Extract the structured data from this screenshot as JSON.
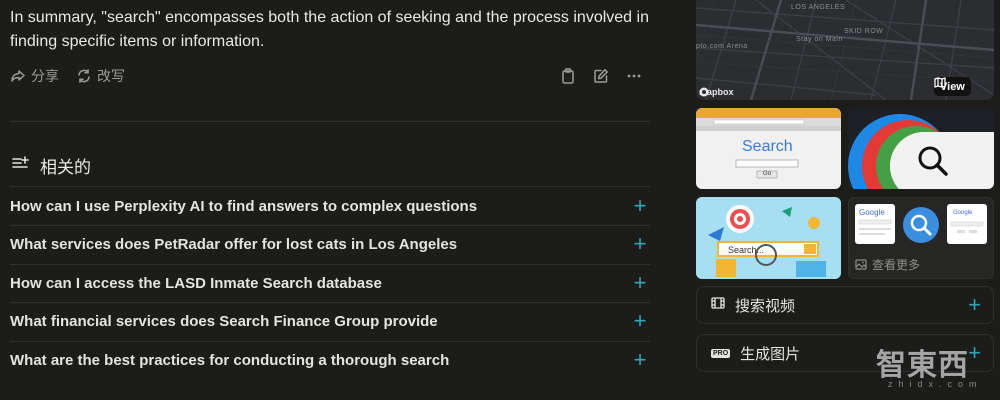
{
  "answer": {
    "summary": "In summary, \"search\" encompasses both the action of seeking and the process involved in finding specific items or information."
  },
  "actions": {
    "share_label": "分享",
    "rewrite_label": "改写"
  },
  "related": {
    "title": "相关的",
    "items": [
      {
        "label": "How can I use Perplexity AI to find answers to complex questions"
      },
      {
        "label": "What services does PetRadar offer for lost cats in Los Angeles"
      },
      {
        "label": "How can I access the LASD Inmate Search database"
      },
      {
        "label": "What financial services does Search Finance Group provide"
      },
      {
        "label": "What are the best practices for conducting a thorough search"
      }
    ]
  },
  "map": {
    "labels": {
      "city": "LOS ANGELES",
      "arena": "pto.com Arena",
      "stay": "Stay on Main",
      "skid": "SKID ROW"
    },
    "brand": "mapbox",
    "view_label": "View"
  },
  "images": {
    "thumb1_search_text": "Search",
    "thumb1_go": "Go",
    "thumb3_search_text": "Search...",
    "thumb4_google": "Google",
    "see_more_label": "查看更多"
  },
  "sidebar": {
    "video_label": "搜索视频",
    "image_label": "生成图片",
    "pro_badge": "PRO"
  },
  "watermark": {
    "cn": "智東西",
    "en": "zhidx.com"
  },
  "colors": {
    "background": "#1c1c1b",
    "accent_plus": "#2fa5b7",
    "muted_text": "#9b9b98"
  }
}
